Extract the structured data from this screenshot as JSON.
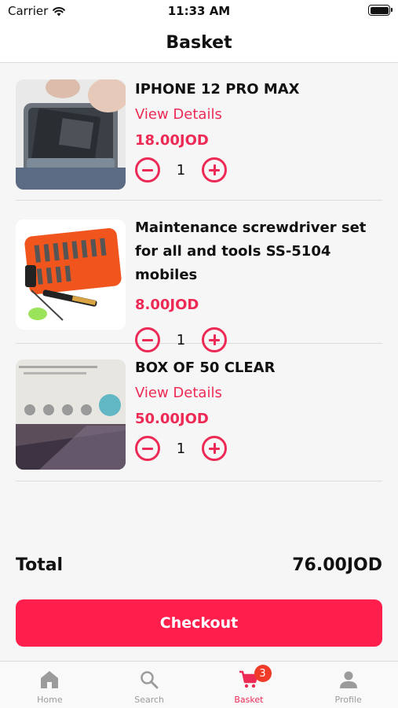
{
  "status": {
    "carrier": "Carrier",
    "time": "11:33 AM"
  },
  "header": {
    "title": "Basket"
  },
  "items": [
    {
      "name": "IPHONE 12 PRO MAX",
      "link": "View Details",
      "price": "18.00JOD",
      "qty": "1"
    },
    {
      "name": "Maintenance screwdriver set for all and tools SS-5104 mobiles",
      "price": "8.00JOD",
      "qty": "1"
    },
    {
      "name": "BOX OF 50 CLEAR",
      "link": "View Details",
      "price": "50.00JOD",
      "qty": "1"
    }
  ],
  "summary": {
    "total_label": "Total",
    "total_value": "76.00JOD"
  },
  "checkout": {
    "label": "Checkout"
  },
  "tabbar": {
    "tabs": [
      {
        "label": "Home",
        "icon": "home-icon"
      },
      {
        "label": "Search",
        "icon": "search-icon"
      },
      {
        "label": "Basket",
        "icon": "cart-icon",
        "badge": "3",
        "active": true
      },
      {
        "label": "Profile",
        "icon": "profile-icon"
      }
    ]
  },
  "colors": {
    "accent": "#ed2a55",
    "button": "#ff1e4c",
    "badge": "#ef3b28"
  }
}
